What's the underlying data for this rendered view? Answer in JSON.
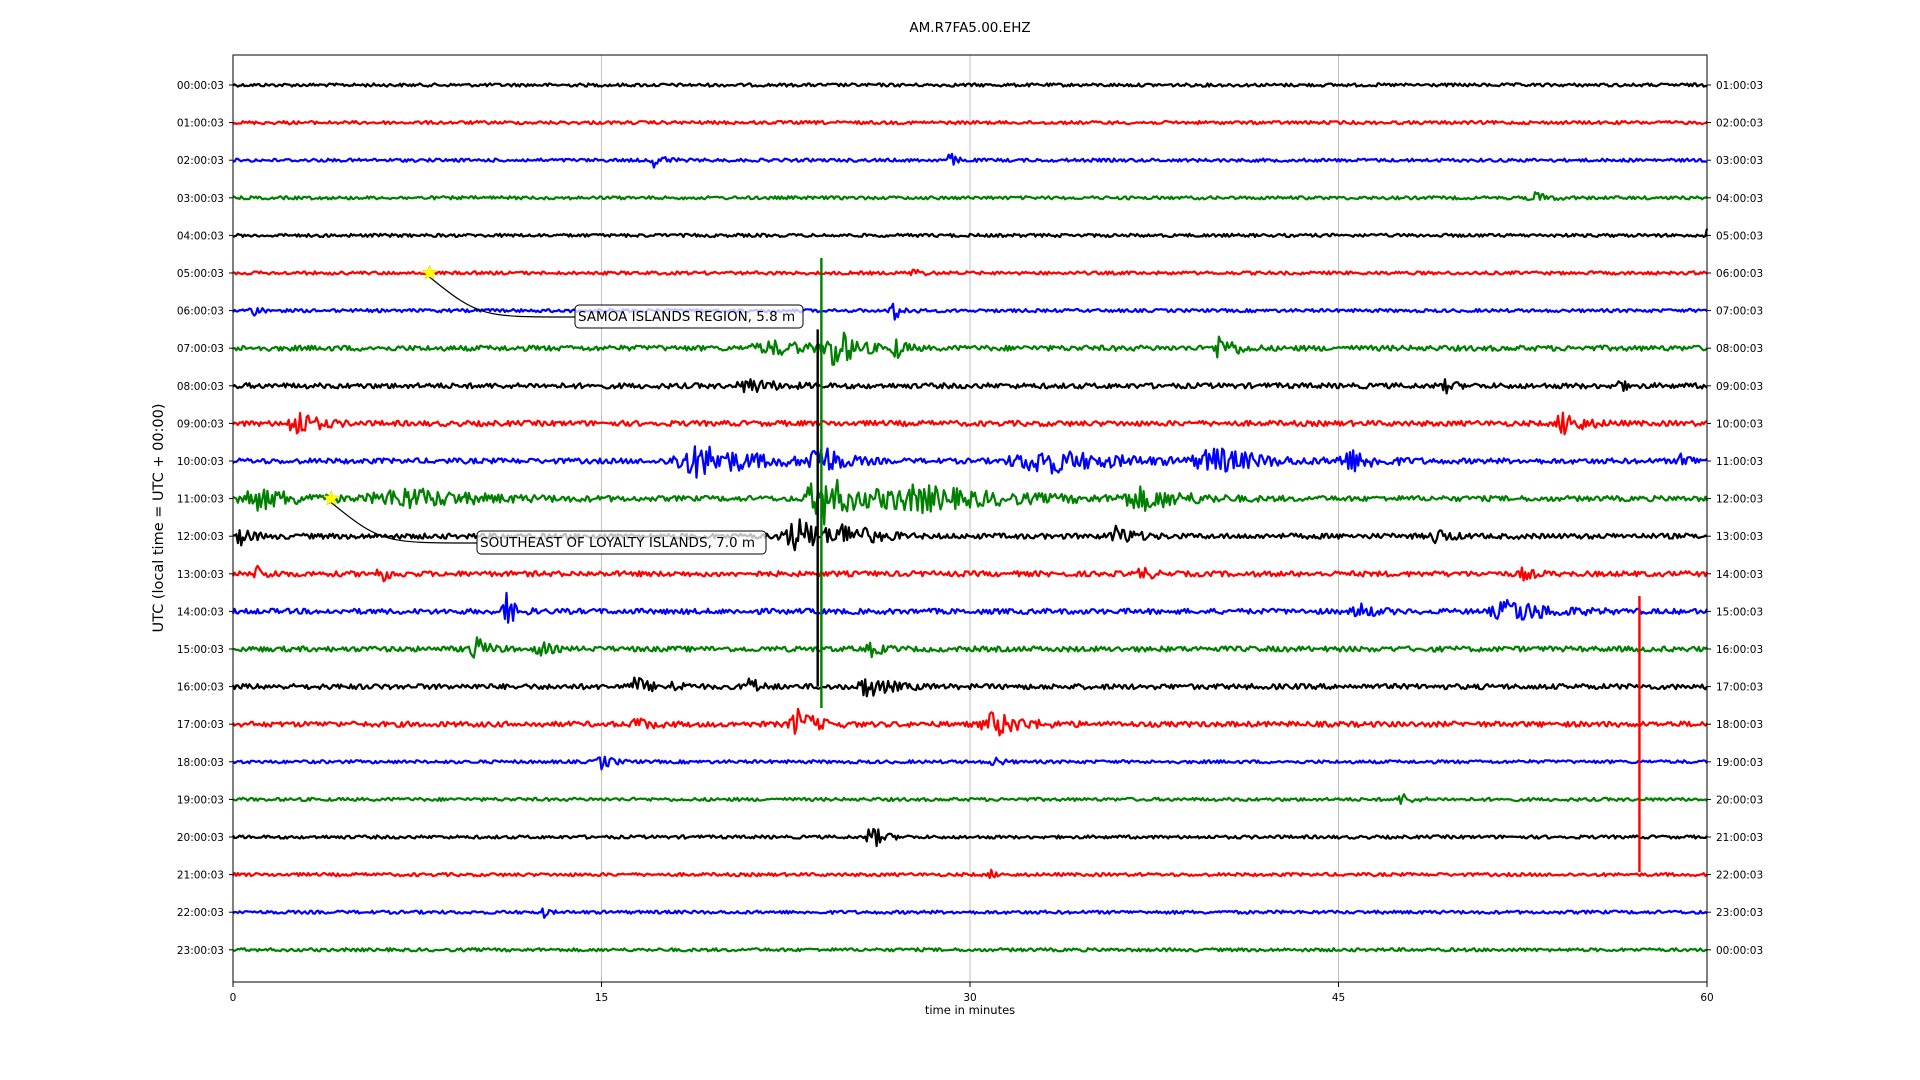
{
  "chart_data": {
    "type": "line",
    "title": "AM.R7FA5.00.EHZ",
    "xlabel": "time in minutes",
    "ylabel": "UTC (local time = UTC + 00:00)",
    "xlim": [
      0,
      60
    ],
    "x_ticks": [
      "0",
      "15",
      "30",
      "45",
      "60"
    ],
    "grid": "vertical",
    "colors": [
      "#000000",
      "#ff0000",
      "#0000ff",
      "#008000"
    ],
    "left_labels": [
      "00:00:03",
      "01:00:03",
      "02:00:03",
      "03:00:03",
      "04:00:03",
      "05:00:03",
      "06:00:03",
      "07:00:03",
      "08:00:03",
      "09:00:03",
      "10:00:03",
      "11:00:03",
      "12:00:03",
      "13:00:03",
      "14:00:03",
      "15:00:03",
      "16:00:03",
      "17:00:03",
      "18:00:03",
      "19:00:03",
      "20:00:03",
      "21:00:03",
      "22:00:03",
      "23:00:03"
    ],
    "right_labels": [
      "01:00:03",
      "02:00:03",
      "03:00:03",
      "04:00:03",
      "05:00:03",
      "06:00:03",
      "07:00:03",
      "08:00:03",
      "09:00:03",
      "10:00:03",
      "11:00:03",
      "12:00:03",
      "13:00:03",
      "14:00:03",
      "15:00:03",
      "16:00:03",
      "17:00:03",
      "18:00:03",
      "19:00:03",
      "20:00:03",
      "21:00:03",
      "22:00:03",
      "23:00:03",
      "00:00:03"
    ],
    "events": [
      {
        "label": "SAMOA ISLANDS REGION, 5.8 m",
        "hour_row": 5,
        "minute": 8.0
      },
      {
        "label": "SOUTHEAST OF LOYALTY ISLANDS, 7.0 m",
        "hour_row": 11,
        "minute": 4.0
      }
    ]
  }
}
